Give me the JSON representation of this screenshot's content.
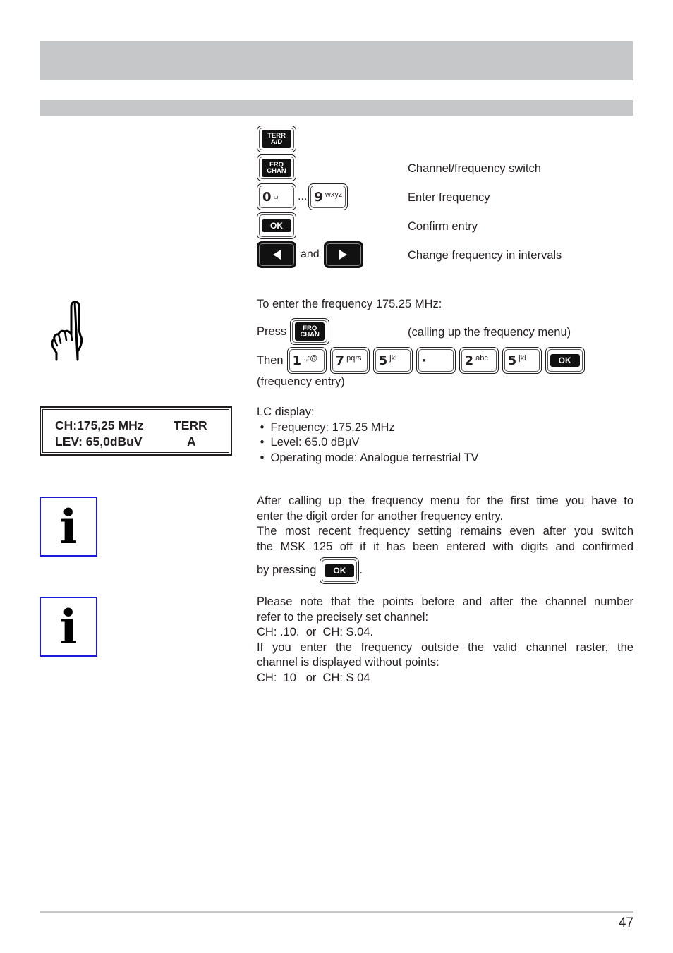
{
  "page": {
    "number": "47"
  },
  "key_legend": [
    {
      "keys": [
        "TERR A/D"
      ],
      "description": ""
    },
    {
      "keys": [
        "FRQ CHAN"
      ],
      "description": "Channel/frequency switch"
    },
    {
      "keys": [
        "0 ␣",
        "9 wxyz"
      ],
      "separator": "...",
      "description": "Enter frequency"
    },
    {
      "keys": [
        "OK"
      ],
      "description": "Confirm entry"
    },
    {
      "keys": [
        "left-arrow",
        "right-arrow"
      ],
      "separator": "and",
      "description": "Change frequency in intervals"
    }
  ],
  "keys": {
    "terr_top": "TERR",
    "terr_bottom": "A/D",
    "frq_top": "FRQ",
    "frq_bottom": "CHAN",
    "zero_main": "0",
    "zero_sub": "␣",
    "nine_main": "9",
    "nine_sub": "wxyz",
    "ok": "OK",
    "dots": "...",
    "and": "and"
  },
  "example": {
    "intro": "To enter the frequency 175.25 MHz:",
    "press_label": "Press",
    "press_note": "(calling up the frequency menu)",
    "then_label": "Then",
    "entry_keys": [
      {
        "main": "1",
        "sub": ".,:@"
      },
      {
        "main": "7",
        "sub": "pqrs"
      },
      {
        "main": "5",
        "sub": "jkl"
      },
      {
        "main": "·",
        "sub": ""
      },
      {
        "main": "2",
        "sub": "abc"
      },
      {
        "main": "5",
        "sub": "jkl"
      }
    ],
    "entry_ok": "OK",
    "entry_note": "(frequency entry)"
  },
  "lcd_display": {
    "line1_left": "CH:175,25 MHz",
    "line1_right": "TERR",
    "line2_left": "LEV: 65,0dBuV",
    "line2_right": "A"
  },
  "lcd_description": {
    "title": "LC display:",
    "bullets": [
      "Frequency: 175.25 MHz",
      "Level: 65.0 dBµV",
      "Operating mode: Analogue terrestrial TV"
    ]
  },
  "note1": {
    "line1": "After calling up the frequency menu for the first time you have to",
    "line2": "enter the digit order for another frequency entry.",
    "line3": "The most recent frequency setting remains even after you switch",
    "line4": "the MSK 125 off if it has been entered with digits and confirmed",
    "line5_prefix": "by pressing",
    "line5_key": "OK",
    "line5_suffix": "."
  },
  "note2": {
    "line1": "Please note that the points before and after the channel number",
    "line2": "refer to the precisely set channel:",
    "line3": "CH: .10.  or  CH: S.04.",
    "line4": "If you enter the frequency outside the valid channel raster, the",
    "line5": "channel is displayed without points:",
    "line6": "CH:  10   or  CH: S 04"
  },
  "icons": {
    "info": "i"
  }
}
